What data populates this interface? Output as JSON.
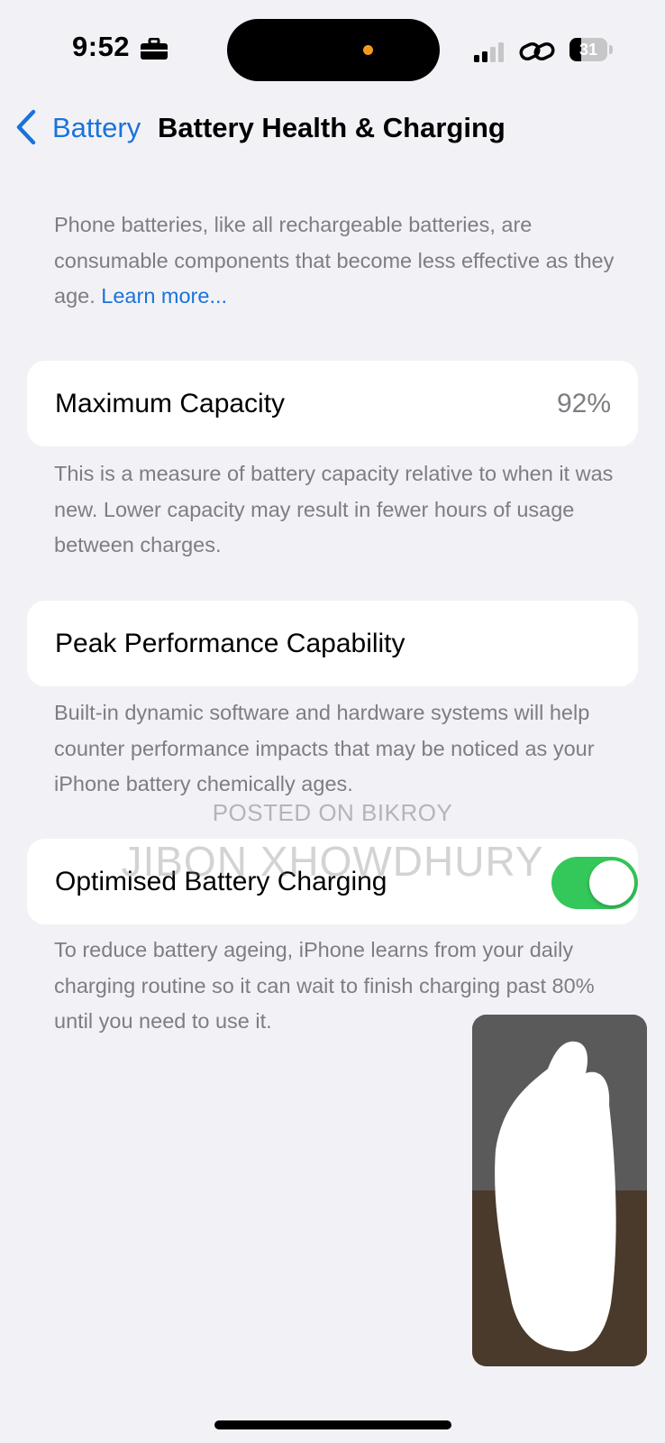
{
  "status_bar": {
    "time": "9:52",
    "briefcase_icon": "briefcase-icon",
    "signal_icon": "cellular-signal-icon",
    "link_icon": "link-icon",
    "battery_level": "31",
    "battery_fraction": 0.31
  },
  "nav": {
    "back_label": "Battery",
    "title": "Battery Health & Charging"
  },
  "intro": {
    "text": "Phone batteries, like all rechargeable batteries, are consumable components that become less effective as they age. ",
    "link": "Learn more..."
  },
  "max_capacity": {
    "label": "Maximum Capacity",
    "value": "92%",
    "footer": "This is a measure of battery capacity relative to when it was new. Lower capacity may result in fewer hours of usage between charges."
  },
  "peak_performance": {
    "label": "Peak Performance Capability",
    "footer": "Built-in dynamic software and hardware systems will help counter performance impacts that may be noticed as your iPhone battery chemically ages."
  },
  "optimised_charging": {
    "label": "Optimised Battery Charging",
    "enabled": true,
    "footer": "To reduce battery ageing, iPhone learns from your daily charging routine so it can wait to finish charging past 80% until you need to use it."
  },
  "watermarks": {
    "small": "POSTED ON BIKROY",
    "large": "JIBON XHOWDHURY"
  },
  "colors": {
    "accent": "#1a73d9",
    "toggle_on": "#34c759",
    "background": "#f2f2f6",
    "secondary_text": "#7d7d82"
  }
}
